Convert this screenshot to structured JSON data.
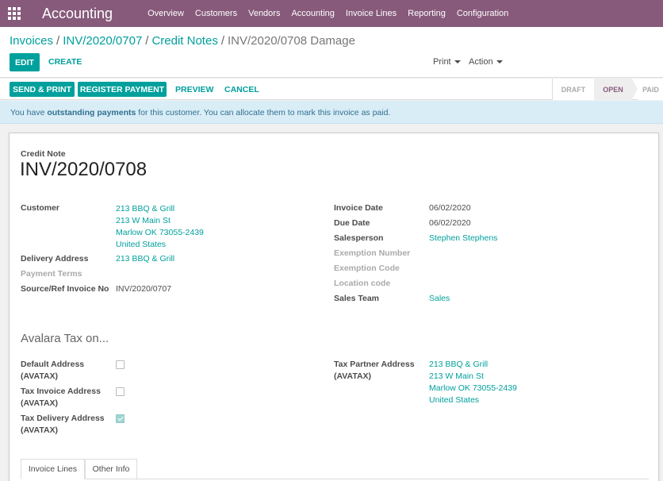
{
  "navbar": {
    "brand": "Accounting",
    "items": [
      "Overview",
      "Customers",
      "Vendors",
      "Accounting",
      "Invoice Lines",
      "Reporting",
      "Configuration"
    ]
  },
  "breadcrumb": {
    "crumbs": [
      "Invoices",
      "INV/2020/0707",
      "Credit Notes"
    ],
    "separator": "/",
    "current": "INV/2020/0708 Damage"
  },
  "control": {
    "edit_label": "EDIT",
    "create_label": "CREATE",
    "print_label": "Print",
    "action_label": "Action"
  },
  "statusbar": {
    "send_print_label": "SEND & PRINT",
    "register_payment_label": "REGISTER PAYMENT",
    "preview_label": "PREVIEW",
    "cancel_label": "CANCEL",
    "stages": [
      "DRAFT",
      "OPEN",
      "PAID"
    ],
    "active_stage": "OPEN"
  },
  "alert": {
    "prefix": "You have ",
    "bold": "outstanding payments",
    "suffix": " for this customer. You can allocate them to mark this invoice as paid."
  },
  "sheet": {
    "doc_type": "Credit Note",
    "doc_name": "INV/2020/0708",
    "left_fields": {
      "customer_label": "Customer",
      "customer_lines": [
        "213 BBQ & Grill",
        "213 W Main St",
        "Marlow OK 73055-2439",
        "United States"
      ],
      "delivery_label": "Delivery Address",
      "delivery_value": "213 BBQ & Grill",
      "payment_terms_label": "Payment Terms",
      "source_label": "Source/Ref Invoice No",
      "source_value": "INV/2020/0707"
    },
    "right_fields": {
      "invoice_date_label": "Invoice Date",
      "invoice_date_value": "06/02/2020",
      "due_date_label": "Due Date",
      "due_date_value": "06/02/2020",
      "salesperson_label": "Salesperson",
      "salesperson_value": "Stephen Stephens",
      "exemption_number_label": "Exemption Number",
      "exemption_code_label": "Exemption Code",
      "location_code_label": "Location code",
      "sales_team_label": "Sales Team",
      "sales_team_value": "Sales"
    },
    "avalara": {
      "title": "Avalara Tax on...",
      "default_address_label": [
        "Default Address",
        "(AVATAX)"
      ],
      "default_address_checked": false,
      "tax_invoice_label": [
        "Tax Invoice Address",
        "(AVATAX)"
      ],
      "tax_invoice_checked": false,
      "tax_delivery_label": [
        "Tax Delivery Address",
        "(AVATAX)"
      ],
      "tax_delivery_checked": true,
      "tax_partner_label": [
        "Tax Partner Address",
        "(AVATAX)"
      ],
      "tax_partner_lines": [
        "213 BBQ & Grill",
        "213 W Main St",
        "Marlow OK 73055-2439",
        "United States"
      ]
    },
    "tabs": [
      "Invoice Lines",
      "Other Info"
    ],
    "active_tab": "Invoice Lines"
  },
  "colors": {
    "navbar": "#875a7b",
    "primary": "#00A09D",
    "alert_bg": "#d9edf7",
    "alert_text": "#31708f"
  }
}
